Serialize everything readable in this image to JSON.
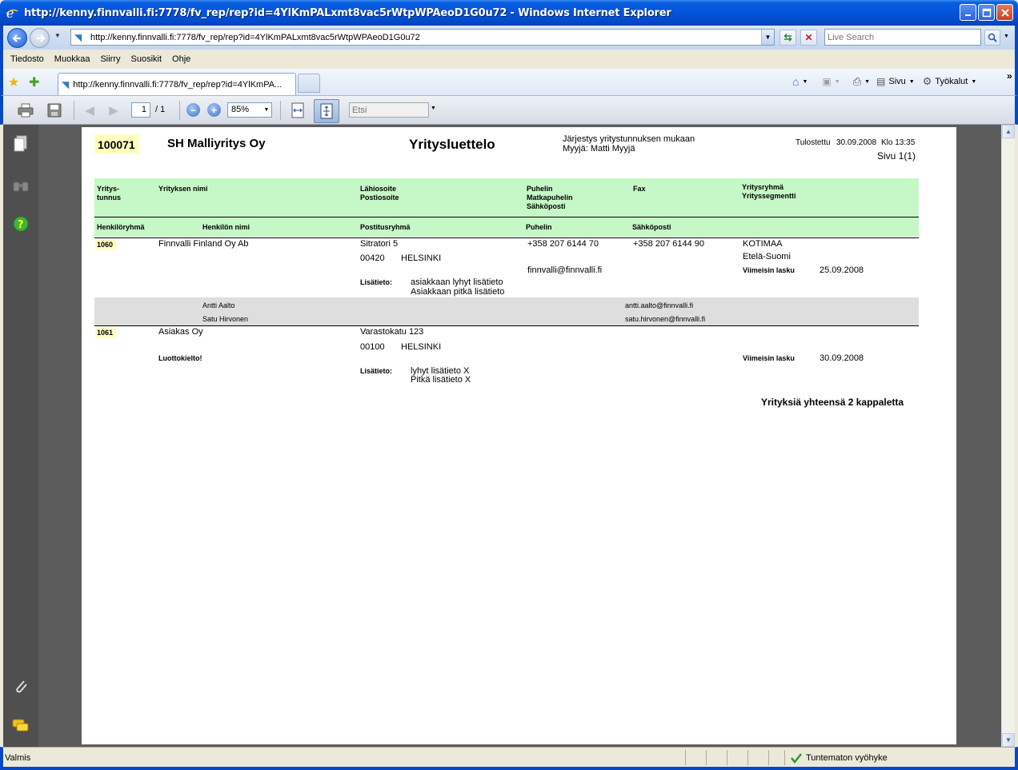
{
  "window": {
    "title": "http://kenny.finnvalli.fi:7778/fv_rep/rep?id=4YlKmPALxmt8vac5rWtpWPAeoD1G0u72 - Windows Internet Explorer"
  },
  "address": {
    "url": "http://kenny.finnvalli.fi:7778/fv_rep/rep?id=4YlKmPALxmt8vac5rWtpWPAeoD1G0u72",
    "search_placeholder": "Live Search"
  },
  "menu": {
    "items": [
      "Tiedosto",
      "Muokkaa",
      "Siirry",
      "Suosikit",
      "Ohje"
    ]
  },
  "tab": {
    "title": "http://kenny.finnvalli.fi:7778/fv_rep/rep?id=4YlKmPA..."
  },
  "commandbar": {
    "page_label": "Sivu",
    "tools_label": "Työkalut",
    "more": "»"
  },
  "pdf_toolbar": {
    "page_current": "1",
    "page_total": "/ 1",
    "zoom": "85%",
    "find_placeholder": "Etsi"
  },
  "report": {
    "company_code": "100071",
    "company_name": "SH Malliyritys Oy",
    "title": "Yritysluettelo",
    "sort_info": "Järjestys yritystunnuksen mukaan",
    "seller": "Myyjä: Matti Myyjä",
    "printed_label": "Tulostettu",
    "printed_date": "30.09.2008",
    "printed_time": "Klo 13:35",
    "page_info": "Sivu 1(1)",
    "headers": {
      "code_1": "Yritys-",
      "code_2": "tunnus",
      "name": "Yrityksen nimi",
      "street": "Lähiosoite",
      "postal": "Postiosoite",
      "phone": "Puhelin",
      "mobile": "Matkapuhelin",
      "email": "Sähköposti",
      "fax": "Fax",
      "group": "Yritysryhmä",
      "segment": "Yrityssegmentti",
      "person_group": "Henkilöryhmä",
      "person_name": "Henkilön nimi",
      "mail_group": "Postitusryhmä",
      "person_phone": "Puhelin",
      "person_email": "Sähköposti"
    },
    "companies": [
      {
        "code": "1060",
        "name": "Finnvalli Finland Oy Ab",
        "street": "Sitratori 5",
        "zip": "00420",
        "city": "HELSINKI",
        "phone": "+358 207 6144 70",
        "fax": "+358 207 6144 90",
        "email": "finnvalli@finnvalli.fi",
        "group": "KOTIMAA",
        "segment": "Etelä-Suomi",
        "last_invoice_label": "Viimeisin lasku",
        "last_invoice": "25.09.2008",
        "info_label": "Lisätieto:",
        "info_short": "asiakkaan lyhyt lisätieto",
        "info_long": "Asiakkaan pitkä lisätieto",
        "persons": [
          {
            "name": "Antti Aalto",
            "email": "antti.aalto@finnvalli.fi"
          },
          {
            "name": "Satu Hirvonen",
            "email": "satu.hirvonen@finnvalli.fi"
          }
        ]
      },
      {
        "code": "1061",
        "name": "Asiakas Oy",
        "street": "Varastokatu 123",
        "zip": "00100",
        "city": "HELSINKI",
        "credit_block": "Luottokielto!",
        "last_invoice_label": "Viimeisin lasku",
        "last_invoice": "30.09.2008",
        "info_label": "Lisätieto:",
        "info_short": "lyhyt lisätieto X",
        "info_long": "Pitkä lisätieto X"
      }
    ],
    "total": "Yrityksiä yhteensä 2 kappaletta"
  },
  "status": {
    "text": "Valmis",
    "zone": "Tuntematon vyöhyke"
  }
}
